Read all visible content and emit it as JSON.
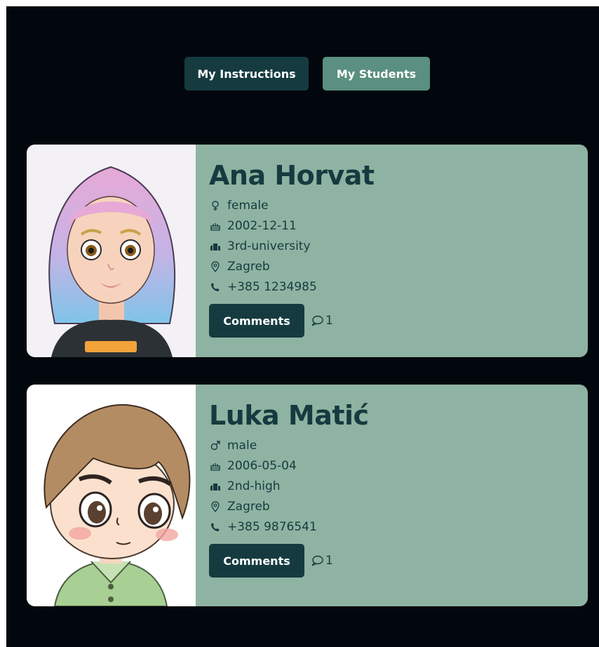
{
  "nav": {
    "instructions_label": "My Instructions",
    "students_label": "My Students"
  },
  "colors": {
    "background": "#02070d",
    "dark_teal": "#153b40",
    "active_tab": "#5b8f7f",
    "card": "#8fb3a2"
  },
  "students": [
    {
      "name": "Ana Horvat",
      "gender": "female",
      "birthdate": "2002-12-11",
      "education": "3rd-university",
      "city": "Zagreb",
      "phone": "+385 1234985",
      "comments_label": "Comments",
      "comment_count": "1",
      "avatar": "girl-avatar"
    },
    {
      "name": "Luka Matić",
      "gender": "male",
      "birthdate": "2006-05-04",
      "education": "2nd-high",
      "city": "Zagreb",
      "phone": "+385 9876541",
      "comments_label": "Comments",
      "comment_count": "1",
      "avatar": "boy-avatar"
    }
  ]
}
